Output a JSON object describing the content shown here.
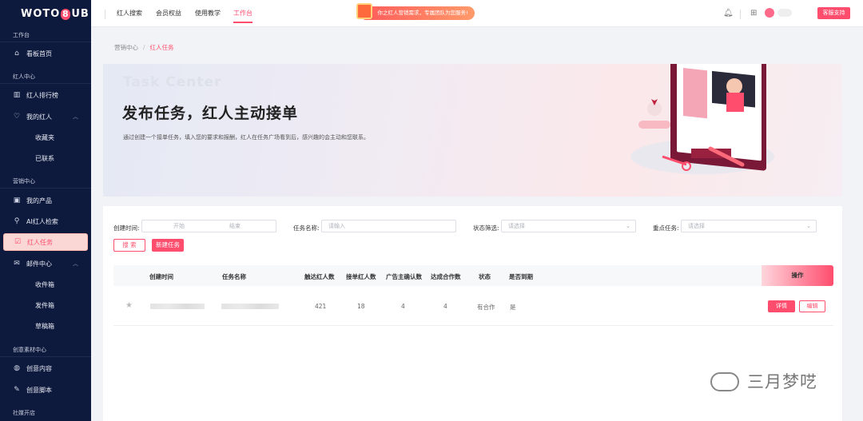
{
  "app": {
    "logo": "WOTO8UB"
  },
  "sidebar": {
    "sections": [
      {
        "label": "工作台"
      },
      {
        "label": "红人中心"
      },
      {
        "label": "营销中心"
      },
      {
        "label": "创意素材中心"
      },
      {
        "label": "社媒开店"
      }
    ],
    "items": [
      {
        "label": "看板首页",
        "icon": "home-icon"
      },
      {
        "label": "红人排行榜",
        "icon": "bar-chart-icon"
      },
      {
        "label": "我的红人",
        "icon": "heart-icon"
      },
      {
        "label": "收藏夹"
      },
      {
        "label": "已联系"
      },
      {
        "label": "我的产品",
        "icon": "bag-icon"
      },
      {
        "label": "AI红人检索",
        "icon": "user-search-icon"
      },
      {
        "label": "红人任务",
        "icon": "checklist-icon"
      },
      {
        "label": "邮件中心",
        "icon": "mail-icon"
      },
      {
        "label": "收件箱"
      },
      {
        "label": "发件箱"
      },
      {
        "label": "草稿箱"
      },
      {
        "label": "创意内容",
        "icon": "palette-icon"
      },
      {
        "label": "创意脚本",
        "icon": "pen-icon"
      }
    ]
  },
  "topnav": {
    "items": [
      "红人搜索",
      "会员权益",
      "使用教学",
      "工作台"
    ],
    "active": "工作台",
    "promo": "你之红人营销需求，专属团队为您服务!",
    "support": "客服支持"
  },
  "breadcrumb": {
    "parent": "营销中心",
    "separator": "/",
    "current": "红人任务"
  },
  "banner": {
    "en_title": "Task Center",
    "title": "发布任务，红人主动接单",
    "desc": "通过创建一个接单任务，填入您的要求和报酬，红人在任务广场看到后，感兴趣的会主动和您联系。"
  },
  "filters": {
    "created_label": "创建时间:",
    "start_placeholder": "开始",
    "end_placeholder": "结束",
    "name_label": "任务名称:",
    "name_placeholder": "请输入",
    "status_label": "状态筛选:",
    "status_placeholder": "请选择",
    "key_label": "重点任务:",
    "key_placeholder": "请选择",
    "search_btn": "搜 索",
    "new_btn": "新建任务"
  },
  "table": {
    "headers": [
      "创建时间",
      "任务名称",
      "触达红人数",
      "接单红人数",
      "广告主确认数",
      "达成合作数",
      "状态",
      "是否到期",
      "操作"
    ],
    "rows": [
      {
        "reach": "421",
        "accept": "18",
        "confirm": "4",
        "deal": "4",
        "status": "有合作",
        "expired": "是",
        "detail": "详情",
        "edit": "编辑"
      }
    ]
  },
  "watermark": "三月梦呓",
  "colors": {
    "accent": "#ff4d6d",
    "sidebar_bg": "#0e1a3d"
  }
}
